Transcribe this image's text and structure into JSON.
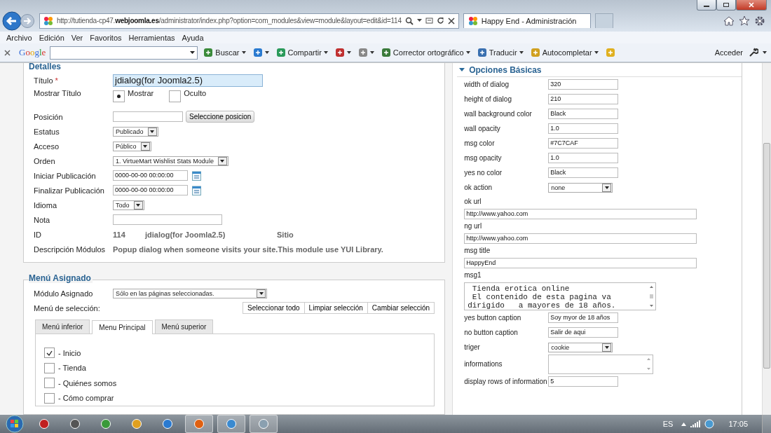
{
  "browser": {
    "url": "http://tutienda-cp47.**webjoomla.es**/administrator/index.php?option=com_modules&view=module&layout=edit&id=114",
    "tabs": [
      {
        "title": "Happy End - Administración",
        "selected": true
      }
    ],
    "menu": [
      "Archivo",
      "Edición",
      "Ver",
      "Favoritos",
      "Herramientas",
      "Ayuda"
    ],
    "toolbar": {
      "logo": "Google",
      "items": [
        {
          "label": "Buscar",
          "dropdown": true
        },
        {
          "dropdown": true
        },
        {
          "label": "Compartir",
          "dropdown": true
        },
        {
          "dropdown": true
        },
        {
          "dropdown": true
        },
        {
          "label": "Corrector ortográfico",
          "dropdown": true
        },
        {
          "label": "Traducir",
          "dropdown": true
        },
        {
          "label": "Autocompletar",
          "dropdown": true
        },
        {
          "dropdown": false
        }
      ],
      "account": "Acceder"
    }
  },
  "details": {
    "legend": "Detalles",
    "fields": [
      {
        "kind": "input",
        "label": "Título",
        "required_mark": "*",
        "value": "jdialog(for Joomla2.5)",
        "focused": true
      },
      {
        "kind": "radio",
        "label": "Mostrar Título",
        "options": [
          {
            "label": "Mostrar",
            "selected": true
          },
          {
            "label": "Oculto",
            "selected": false
          }
        ]
      },
      {
        "kind": "input_button",
        "label": "Posición",
        "button": "Seleccione posicion"
      },
      {
        "kind": "select",
        "label": "Estatus",
        "value": "Publicado"
      },
      {
        "kind": "select",
        "label": "Acceso",
        "value": "Público"
      },
      {
        "kind": "select",
        "label": "Orden",
        "value": "1. VirtueMart Wishlist Stats Module"
      },
      {
        "kind": "date",
        "label": "Iniciar Publicación",
        "value": "0000-00-00 00:00:00"
      },
      {
        "kind": "date",
        "label": "Finalizar Publicación",
        "value": "0000-00-00 00:00:00"
      },
      {
        "kind": "select",
        "label": "Idioma",
        "value": "Todo"
      },
      {
        "kind": "input",
        "label": "Nota",
        "focused": false
      },
      {
        "kind": "info",
        "label": "ID",
        "values": [
          "114",
          "jdialog(for Joomla2.5)",
          "Sitio"
        ]
      },
      {
        "kind": "info",
        "label": "Descripción Módulos",
        "values": [
          "Popup dialog when someone visits your site.This module use YUI Library."
        ]
      }
    ]
  },
  "menu_assignment": {
    "legend": "Menú Asignado",
    "assign_label": "Módulo Asignado",
    "assign_value": "Sólo en las páginas seleccionadas.",
    "selection_label": "Menú de selección:",
    "buttons": [
      "Seleccionar todo",
      "Limpiar selección",
      "Cambiar selección"
    ],
    "tabs": [
      {
        "label": "Menú inferior",
        "selected": false
      },
      {
        "label": "Menu Principal",
        "selected": true
      },
      {
        "label": "Menú superior",
        "selected": false
      }
    ],
    "items": [
      {
        "label": "- Inicio",
        "checked": true
      },
      {
        "label": "- Tienda",
        "checked": false
      },
      {
        "label": "- Quiénes somos",
        "checked": false
      },
      {
        "label": "- Cómo comprar",
        "checked": false
      }
    ]
  },
  "basic_options": {
    "title": "Opciones Básicas",
    "expanded": true,
    "fields": [
      {
        "kind": "input",
        "label": "width of dialog",
        "value": "320"
      },
      {
        "kind": "input",
        "label": "height of dialog",
        "value": "210"
      },
      {
        "kind": "input",
        "label": "wall background color",
        "value": "Black"
      },
      {
        "kind": "input",
        "label": "wall opacity",
        "value": "1.0"
      },
      {
        "kind": "input",
        "label": "msg color",
        "value": "#7C7CAF"
      },
      {
        "kind": "input",
        "label": "msg opacity",
        "value": "1.0"
      },
      {
        "kind": "input",
        "label": "yes no color",
        "value": "Black"
      },
      {
        "kind": "select",
        "label": "ok action",
        "value": "none"
      },
      {
        "kind": "url",
        "label": "ok url",
        "value": "http://www.yahoo.com"
      },
      {
        "kind": "url",
        "label": "ng url",
        "value": "http://www.yahoo.com"
      },
      {
        "kind": "url",
        "label": "msg title",
        "value": "HappyEnd"
      },
      {
        "kind": "textarea",
        "label": "msg1",
        "value": " Tienda erotica online\n El contenido de esta pagina va\ndirigido   a mayores de 18 años."
      },
      {
        "kind": "input",
        "label": "yes button caption",
        "value": "Soy myor de 18 años"
      },
      {
        "kind": "input",
        "label": "no button caption",
        "value": "Salir de aqui"
      },
      {
        "kind": "select",
        "label": "triger",
        "value": "cookie"
      },
      {
        "kind": "list",
        "label": "informations"
      },
      {
        "kind": "input",
        "label": "display rows of information",
        "value": "5"
      }
    ]
  },
  "taskbar": {
    "language": "ES",
    "time": "17:05"
  }
}
